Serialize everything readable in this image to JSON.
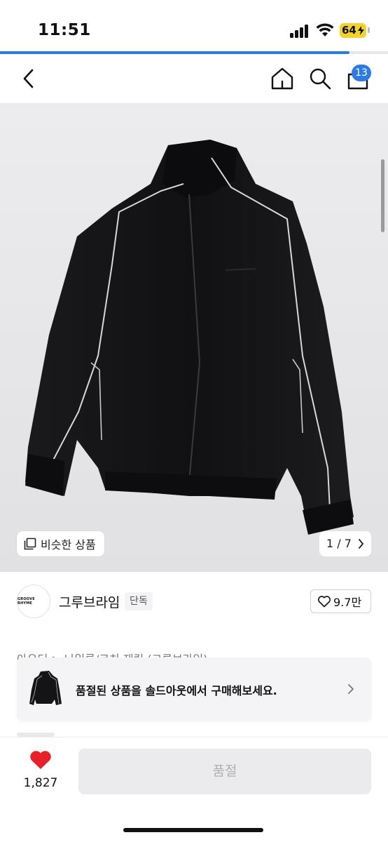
{
  "status_bar": {
    "time": "11:51",
    "battery": "64"
  },
  "page_load_progress": 0.9,
  "header": {
    "back_icon": "chevron-left-icon",
    "home_icon": "home-icon",
    "search_icon": "search-icon",
    "bag_icon": "shopping-bag-icon",
    "cart_count": "13"
  },
  "gallery": {
    "similar_label": "비슷한 상품",
    "page_counter": "1 / 7",
    "counter_icon": "chevron-right-icon"
  },
  "brand": {
    "logo_text": "GROOVE RHYME",
    "name": "그루브라임",
    "tag": "단독",
    "likes": "9.7만"
  },
  "breadcrumb": "아우터 > 나일론/코치 재킷 (그루브라임)",
  "toast": {
    "message": "품절된 상품을 솔드아웃에서 구매해보세요."
  },
  "bottom_bar": {
    "wish_count": "1,827",
    "buy_label": "품절"
  },
  "colors": {
    "accent": "#2c7be5",
    "heart": "#e8202a",
    "battery": "#f2d22e"
  }
}
